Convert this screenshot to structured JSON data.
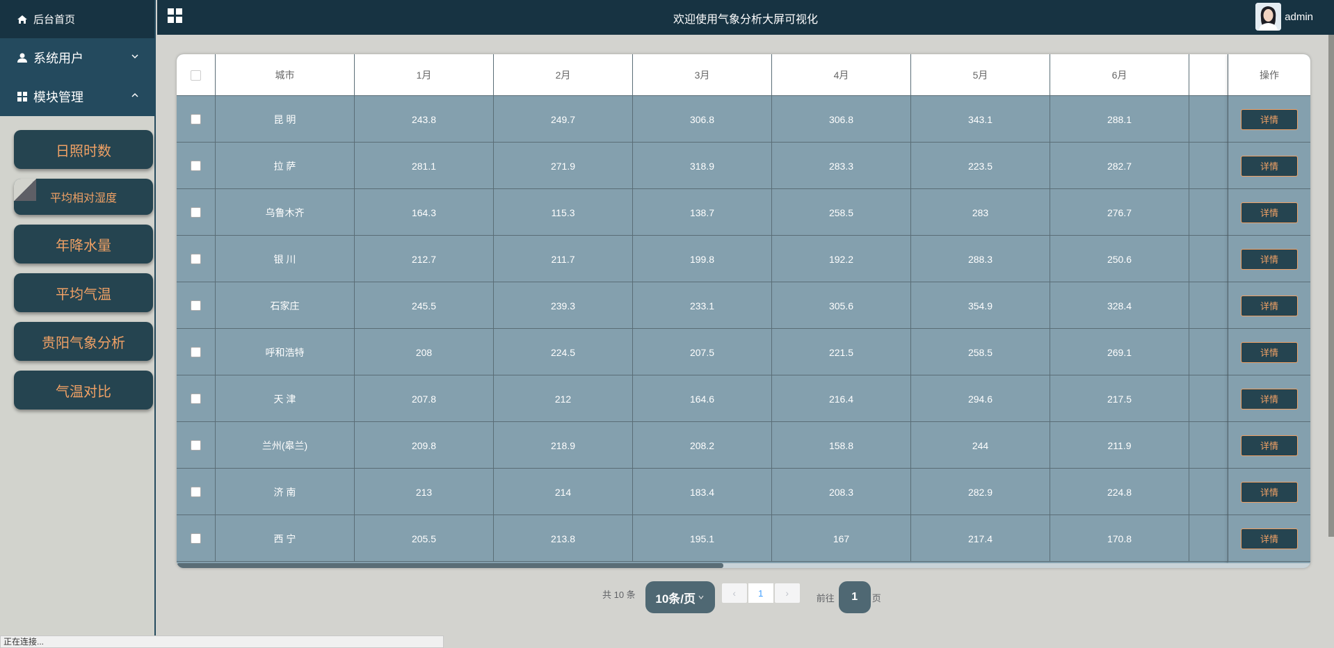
{
  "sidebar": {
    "home_label": "后台首页",
    "menu_users": "系统用户",
    "menu_modules": "模块管理",
    "sub_items": [
      {
        "label": "日照时数"
      },
      {
        "label": "平均相对湿度"
      },
      {
        "label": "年降水量"
      },
      {
        "label": "平均气温"
      },
      {
        "label": "贵阳气象分析"
      },
      {
        "label": "气温对比"
      }
    ]
  },
  "header": {
    "title": "欢迎使用气象分析大屏可视化",
    "user": "admin"
  },
  "table": {
    "columns": [
      "城市",
      "1月",
      "2月",
      "3月",
      "4月",
      "5月",
      "6月",
      "",
      "操作"
    ],
    "rows": [
      {
        "city": "昆 明",
        "m1": "243.8",
        "m2": "249.7",
        "m3": "306.8",
        "m4": "306.8",
        "m5": "343.1",
        "m6": "288.1",
        "action": "详情"
      },
      {
        "city": "拉 萨",
        "m1": "281.1",
        "m2": "271.9",
        "m3": "318.9",
        "m4": "283.3",
        "m5": "223.5",
        "m6": "282.7",
        "action": "详情"
      },
      {
        "city": "乌鲁木齐",
        "m1": "164.3",
        "m2": "115.3",
        "m3": "138.7",
        "m4": "258.5",
        "m5": "283",
        "m6": "276.7",
        "action": "详情"
      },
      {
        "city": "银 川",
        "m1": "212.7",
        "m2": "211.7",
        "m3": "199.8",
        "m4": "192.2",
        "m5": "288.3",
        "m6": "250.6",
        "action": "详情"
      },
      {
        "city": "石家庄",
        "m1": "245.5",
        "m2": "239.3",
        "m3": "233.1",
        "m4": "305.6",
        "m5": "354.9",
        "m6": "328.4",
        "action": "详情"
      },
      {
        "city": "呼和浩特",
        "m1": "208",
        "m2": "224.5",
        "m3": "207.5",
        "m4": "221.5",
        "m5": "258.5",
        "m6": "269.1",
        "action": "详情"
      },
      {
        "city": "天 津",
        "m1": "207.8",
        "m2": "212",
        "m3": "164.6",
        "m4": "216.4",
        "m5": "294.6",
        "m6": "217.5",
        "action": "详情"
      },
      {
        "city": "兰州(皋兰)",
        "m1": "209.8",
        "m2": "218.9",
        "m3": "208.2",
        "m4": "158.8",
        "m5": "244",
        "m6": "211.9",
        "action": "详情"
      },
      {
        "city": "济 南",
        "m1": "213",
        "m2": "214",
        "m3": "183.4",
        "m4": "208.3",
        "m5": "282.9",
        "m6": "224.8",
        "action": "详情"
      },
      {
        "city": "西 宁",
        "m1": "205.5",
        "m2": "213.8",
        "m3": "195.1",
        "m4": "167",
        "m5": "217.4",
        "m6": "170.8",
        "action": "详情"
      }
    ]
  },
  "pagination": {
    "total": "共 10 条",
    "page_size": "10条/页",
    "prev": "‹",
    "current": "1",
    "next": "›",
    "goto_label": "前往",
    "goto_value": "1",
    "goto_suffix": "页"
  },
  "status_bar": "正在连接..."
}
